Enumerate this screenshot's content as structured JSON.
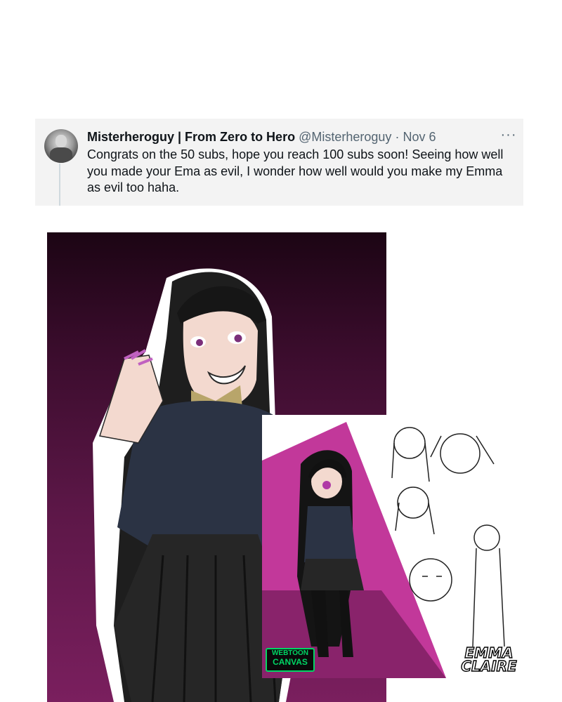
{
  "tweet": {
    "display_name": "Misterheroguy | From Zero to Hero",
    "handle": "@Misterheroguy",
    "separator": "·",
    "date": "Nov 6",
    "more_label": "···",
    "text": "Congrats on the 50 subs, hope you reach 100 subs soon! Seeing how well you made your Ema as evil, I wonder how well would you make my Emma as evil too haha."
  },
  "artwork": {
    "main_desc": "evil-character-illustration",
    "inset": {
      "badge_line1": "WEBTOON",
      "badge_line2": "CANVAS",
      "signature_line1": "EMMA",
      "signature_line2": "CLAIRE"
    }
  }
}
